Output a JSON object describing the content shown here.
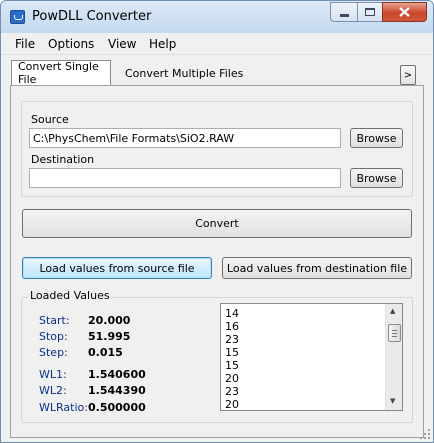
{
  "window": {
    "title": "PowDLL Converter"
  },
  "menu": {
    "file": "File",
    "options": "Options",
    "view": "View",
    "help": "Help"
  },
  "tabs": {
    "single": "Convert Single File",
    "multiple": "Convert Multiple Files",
    "scroll_arrow": ">"
  },
  "source": {
    "label": "Source",
    "value": "C:\\PhysChem\\File Formats\\SiO2.RAW",
    "browse": "Browse"
  },
  "destination": {
    "label": "Destination",
    "value": "",
    "browse": "Browse"
  },
  "convert_button": "Convert",
  "load_source_button": "Load values from source file",
  "load_destination_button": "Load values from destination  file",
  "loaded": {
    "title": "Loaded Values",
    "start_label": "Start:",
    "start_value": "20.000",
    "stop_label": "Stop:",
    "stop_value": "51.995",
    "step_label": "Step:",
    "step_value": "0.015",
    "wl1_label": "WL1:",
    "wl1_value": "1.540600",
    "wl2_label": "WL2:",
    "wl2_value": "1.544390",
    "wlratio_label": "WLRatio:",
    "wlratio_value": "0.500000",
    "list": [
      "14",
      "16",
      "23",
      "15",
      "15",
      "20",
      "23",
      "20"
    ]
  },
  "icons": {
    "app": "app-icon",
    "minimize": "minimize-icon",
    "maximize": "maximize-icon",
    "close": "close-icon",
    "scroll_up": "scroll-up-icon",
    "scroll_down": "scroll-down-icon",
    "resize": "resize-grip-icon"
  },
  "colors": {
    "value_label": "#0c2f8a",
    "close_button": "#c9462c"
  }
}
